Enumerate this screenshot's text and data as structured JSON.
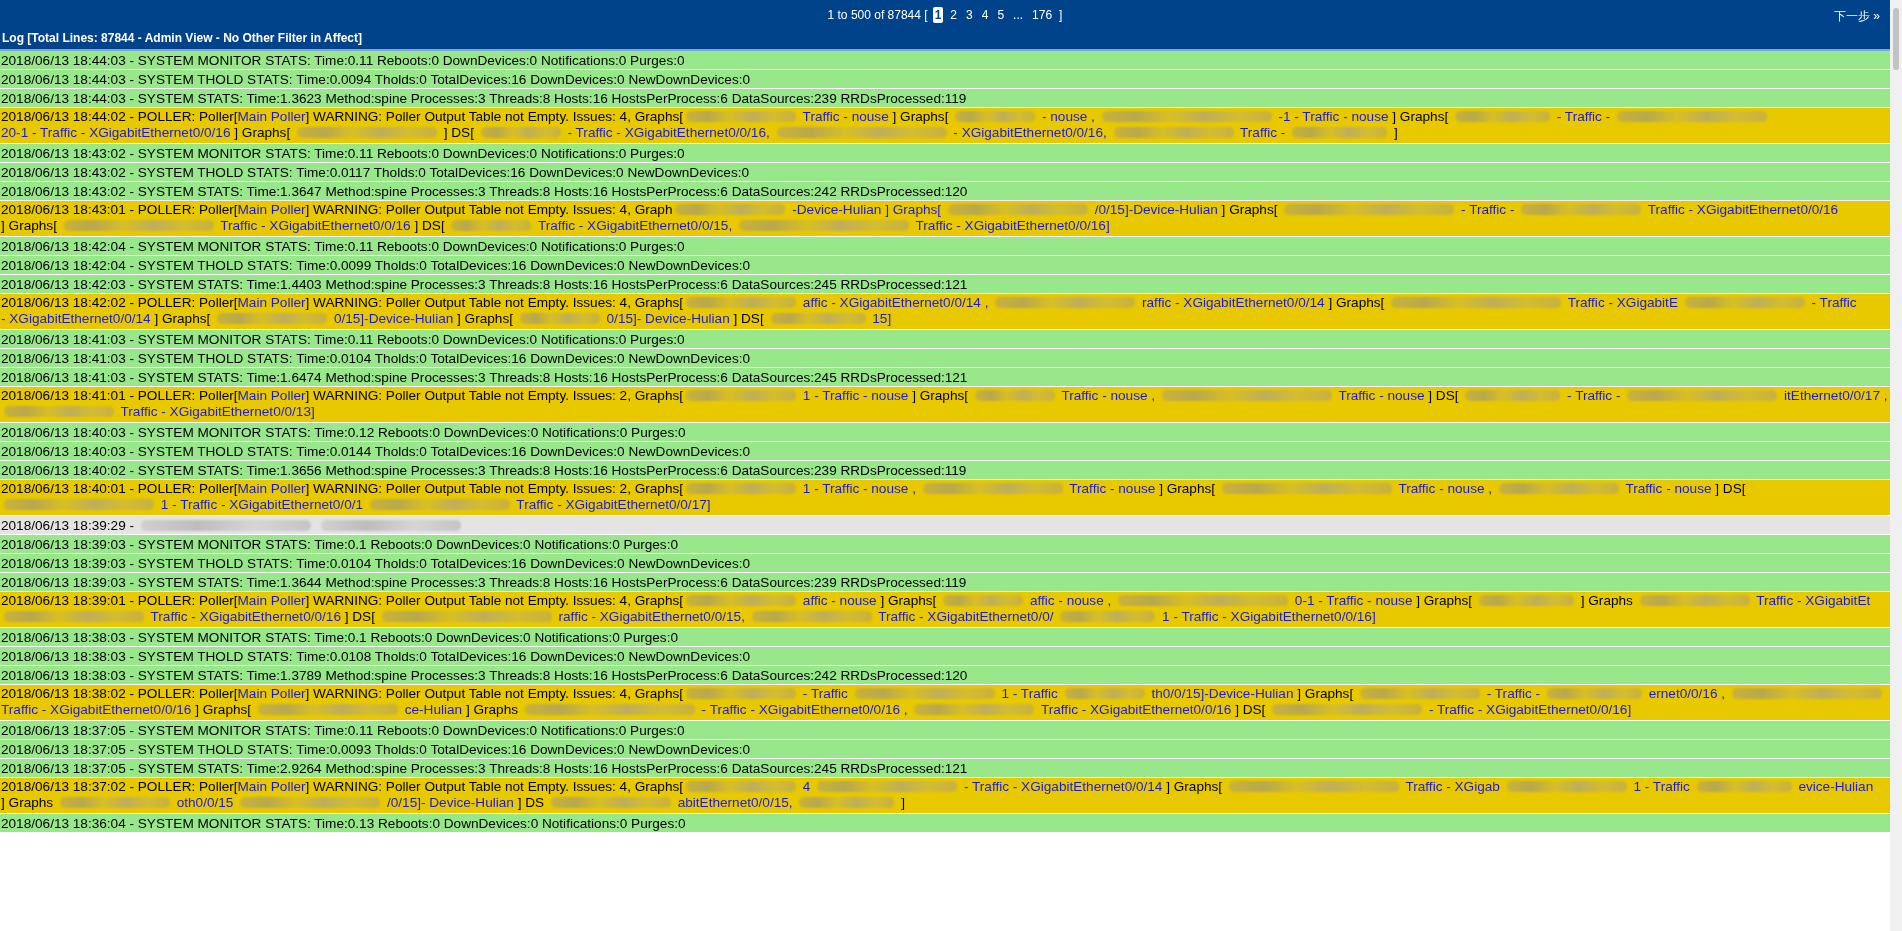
{
  "pager": {
    "summary": "1 to 500 of 87844 [",
    "pages": [
      {
        "label": "1",
        "selected": true
      },
      {
        "label": "2",
        "selected": false
      },
      {
        "label": "3",
        "selected": false
      },
      {
        "label": "4",
        "selected": false
      },
      {
        "label": "5",
        "selected": false
      },
      {
        "label": "...",
        "selected": false
      },
      {
        "label": "176",
        "selected": false
      }
    ],
    "close": "]",
    "next": "下一步 »"
  },
  "title": "Log [Total Lines: 87844 - Admin View - No Other Filter in Affect]",
  "rows": [
    {
      "kind": "info",
      "text": "2018/06/13 18:44:03 - SYSTEM MONITOR STATS: Time:0.11 Reboots:0 DownDevices:0 Notifications:0 Purges:0"
    },
    {
      "kind": "info",
      "text": "2018/06/13 18:44:03 - SYSTEM THOLD STATS: Time:0.0094 Tholds:0 TotalDevices:16 DownDevices:0 NewDownDevices:0"
    },
    {
      "kind": "info",
      "text": "2018/06/13 18:44:03 - SYSTEM STATS: Time:1.3623 Method:spine Processes:3 Threads:8 Hosts:16 HostsPerProcess:6 DataSources:239 RRDsProcessed:119"
    },
    {
      "kind": "warning",
      "prefix": "2018/06/13 18:44:02 - POLLER: Poller[",
      "link": "Main Poller",
      "message": "] WARNING: Poller Output Table not Empty. Issues: 4, Graphs[",
      "segments": [
        {
          "text": "Traffic - nouse",
          "link": true,
          "masked": true
        },
        {
          "text": "] Graphs[",
          "link": false,
          "masked": false
        },
        {
          "text": "- nouse ,",
          "link": true,
          "masked": true
        },
        {
          "text": "-1 - Traffic - nouse",
          "link": true,
          "masked": true
        },
        {
          "text": "] Graphs[",
          "link": false,
          "masked": false
        },
        {
          "text": "- Traffic -",
          "link": true,
          "masked": true
        },
        {
          "text": "20-1 - Traffic - XGigabitEthernet0/0/16",
          "link": true,
          "masked": true
        },
        {
          "text": "] Graphs[",
          "link": false,
          "masked": false
        },
        {
          "text": "] DS[",
          "link": false,
          "masked": true
        },
        {
          "text": "- Traffic - XGigabitEthernet0/0/16,",
          "link": true,
          "masked": true
        },
        {
          "text": "- XGigabitEthernet0/0/16,",
          "link": true,
          "masked": true
        },
        {
          "text": "Traffic -",
          "link": true,
          "masked": true
        },
        {
          "text": "]",
          "link": false,
          "masked": true
        }
      ]
    },
    {
      "kind": "info",
      "text": "2018/06/13 18:43:02 - SYSTEM MONITOR STATS: Time:0.11 Reboots:0 DownDevices:0 Notifications:0 Purges:0"
    },
    {
      "kind": "info",
      "text": "2018/06/13 18:43:02 - SYSTEM THOLD STATS: Time:0.0117 Tholds:0 TotalDevices:16 DownDevices:0 NewDownDevices:0"
    },
    {
      "kind": "info",
      "text": "2018/06/13 18:43:02 - SYSTEM STATS: Time:1.3647 Method:spine Processes:3 Threads:8 Hosts:16 HostsPerProcess:6 DataSources:242 RRDsProcessed:120"
    },
    {
      "kind": "warning",
      "prefix": "2018/06/13 18:43:01 - POLLER: Poller[",
      "link": "Main Poller",
      "message": "] WARNING: Poller Output Table not Empty. Issues: 4, Graph",
      "segments": [
        {
          "text": "-Device-Hulian ] Graphs[",
          "link": true,
          "masked": true
        },
        {
          "text": "/0/15]-Device-Hulian",
          "link": true,
          "masked": true
        },
        {
          "text": "] Graphs[",
          "link": false,
          "masked": false
        },
        {
          "text": "- Traffic -",
          "link": true,
          "masked": true
        },
        {
          "text": "Traffic - XGigabitEthernet0/0/16",
          "link": true,
          "masked": true
        },
        {
          "text": "] Graphs[",
          "link": false,
          "masked": false
        },
        {
          "text": "Traffic -",
          "link": true,
          "masked": true
        },
        {
          "text": "XGigabitEthernet0/0/16",
          "link": true,
          "masked": false
        },
        {
          "text": "] DS[",
          "link": false,
          "masked": false
        },
        {
          "text": "Traffic - XGigabitEthernet0/0/15,",
          "link": true,
          "masked": true
        },
        {
          "text": "Traffic - XGigabitEthernet0/0/16]",
          "link": true,
          "masked": true
        }
      ]
    },
    {
      "kind": "info",
      "text": "2018/06/13 18:42:04 - SYSTEM MONITOR STATS: Time:0.11 Reboots:0 DownDevices:0 Notifications:0 Purges:0"
    },
    {
      "kind": "info",
      "text": "2018/06/13 18:42:04 - SYSTEM THOLD STATS: Time:0.0099 Tholds:0 TotalDevices:16 DownDevices:0 NewDownDevices:0"
    },
    {
      "kind": "info",
      "text": "2018/06/13 18:42:03 - SYSTEM STATS: Time:1.4403 Method:spine Processes:3 Threads:8 Hosts:16 HostsPerProcess:6 DataSources:245 RRDsProcessed:121"
    },
    {
      "kind": "warning",
      "prefix": "2018/06/13 18:42:02 - POLLER: Poller[",
      "link": "Main Poller",
      "message": "] WARNING: Poller Output Table not Empty. Issues: 4, Graphs[",
      "segments": [
        {
          "text": "affic - XGigabitEthernet0/0/14 ,",
          "link": true,
          "masked": true
        },
        {
          "text": "raffic - XGigabitEthernet0/0/14",
          "link": true,
          "masked": true
        },
        {
          "text": "] Graphs[",
          "link": false,
          "masked": false
        },
        {
          "text": "Traffic - XGigabitE",
          "link": true,
          "masked": true
        },
        {
          "text": "- Traffic",
          "link": true,
          "masked": true
        },
        {
          "text": "- XGigabitEthernet0/0/14",
          "link": true,
          "masked": false
        },
        {
          "text": "] Graphs[",
          "link": false,
          "masked": false
        },
        {
          "text": "0/15]-Device-Hulian",
          "link": true,
          "masked": true
        },
        {
          "text": "] Graphs[",
          "link": false,
          "masked": false
        },
        {
          "text": "0/15]-",
          "link": true,
          "masked": true
        },
        {
          "text": "Device-Hulian",
          "link": true,
          "masked": false
        },
        {
          "text": "] DS[",
          "link": false,
          "masked": false
        },
        {
          "text": "15]",
          "link": true,
          "masked": true
        }
      ]
    },
    {
      "kind": "info",
      "text": "2018/06/13 18:41:03 - SYSTEM MONITOR STATS: Time:0.11 Reboots:0 DownDevices:0 Notifications:0 Purges:0"
    },
    {
      "kind": "info",
      "text": "2018/06/13 18:41:03 - SYSTEM THOLD STATS: Time:0.0104 Tholds:0 TotalDevices:16 DownDevices:0 NewDownDevices:0"
    },
    {
      "kind": "info",
      "text": "2018/06/13 18:41:03 - SYSTEM STATS: Time:1.6474 Method:spine Processes:3 Threads:8 Hosts:16 HostsPerProcess:6 DataSources:245 RRDsProcessed:121"
    },
    {
      "kind": "warning",
      "prefix": "2018/06/13 18:41:01 - POLLER: Poller[",
      "link": "Main Poller",
      "message": "] WARNING: Poller Output Table not Empty. Issues: 2, Graphs[",
      "segments": [
        {
          "text": "1 - Traffic - nouse",
          "link": true,
          "masked": true
        },
        {
          "text": "] Graphs[",
          "link": false,
          "masked": false
        },
        {
          "text": "Traffic - nouse ,",
          "link": true,
          "masked": true
        },
        {
          "text": "Traffic - nouse",
          "link": true,
          "masked": true
        },
        {
          "text": "] DS[",
          "link": false,
          "masked": false
        },
        {
          "text": "- Traffic -",
          "link": true,
          "masked": true
        },
        {
          "text": "itEthernet0/0/17 ,",
          "link": true,
          "masked": true
        },
        {
          "text": "Traffic - XGigabitEthernet0/0/13]",
          "link": true,
          "masked": true
        }
      ]
    },
    {
      "kind": "info",
      "text": "2018/06/13 18:40:03 - SYSTEM MONITOR STATS: Time:0.12 Reboots:0 DownDevices:0 Notifications:0 Purges:0"
    },
    {
      "kind": "info",
      "text": "2018/06/13 18:40:03 - SYSTEM THOLD STATS: Time:0.0144 Tholds:0 TotalDevices:16 DownDevices:0 NewDownDevices:0"
    },
    {
      "kind": "info",
      "text": "2018/06/13 18:40:02 - SYSTEM STATS: Time:1.3656 Method:spine Processes:3 Threads:8 Hosts:16 HostsPerProcess:6 DataSources:239 RRDsProcessed:119"
    },
    {
      "kind": "warning",
      "prefix": "2018/06/13 18:40:01 - POLLER: Poller[",
      "link": "Main Poller",
      "message": "] WARNING: Poller Output Table not Empty. Issues: 2, Graphs[",
      "segments": [
        {
          "text": "1 - Traffic - nouse ,",
          "link": true,
          "masked": true
        },
        {
          "text": "Traffic - nouse",
          "link": true,
          "masked": true
        },
        {
          "text": "] Graphs[",
          "link": false,
          "masked": false
        },
        {
          "text": "Traffic - nouse ,",
          "link": true,
          "masked": true
        },
        {
          "text": "Traffic - nouse",
          "link": true,
          "masked": true
        },
        {
          "text": "] DS[",
          "link": false,
          "masked": false
        },
        {
          "text": "1 - Traffic -",
          "link": true,
          "masked": true
        },
        {
          "text": "XGigabitEthernet0/0/1",
          "link": true,
          "masked": false
        },
        {
          "text": "Traffic - XGigabitEthernet0/0/17]",
          "link": true,
          "masked": true
        }
      ]
    },
    {
      "kind": "other",
      "text": "2018/06/13 18:39:29 -"
    },
    {
      "kind": "info",
      "text": "2018/06/13 18:39:03 - SYSTEM MONITOR STATS: Time:0.1 Reboots:0 DownDevices:0 Notifications:0 Purges:0"
    },
    {
      "kind": "info",
      "text": "2018/06/13 18:39:03 - SYSTEM THOLD STATS: Time:0.0104 Tholds:0 TotalDevices:16 DownDevices:0 NewDownDevices:0"
    },
    {
      "kind": "info",
      "text": "2018/06/13 18:39:03 - SYSTEM STATS: Time:1.3644 Method:spine Processes:3 Threads:8 Hosts:16 HostsPerProcess:6 DataSources:239 RRDsProcessed:119"
    },
    {
      "kind": "warning",
      "prefix": "2018/06/13 18:39:01 - POLLER: Poller[",
      "link": "Main Poller",
      "message": "] WARNING: Poller Output Table not Empty. Issues: 4, Graphs[",
      "segments": [
        {
          "text": "affic - nouse",
          "link": true,
          "masked": true
        },
        {
          "text": "] Graphs[",
          "link": false,
          "masked": false
        },
        {
          "text": "affic - nouse ,",
          "link": true,
          "masked": true
        },
        {
          "text": "0-1 - Traffic - nouse",
          "link": true,
          "masked": true
        },
        {
          "text": "] Graphs[",
          "link": false,
          "masked": false
        },
        {
          "text": "]",
          "link": false,
          "masked": true
        },
        {
          "text": "Graphs",
          "link": false,
          "masked": false
        },
        {
          "text": "Traffic - XGigabitEt",
          "link": true,
          "masked": true
        },
        {
          "text": "Traffic - XGigabitEthernet0/0/16",
          "link": true,
          "masked": true
        },
        {
          "text": "] DS[",
          "link": false,
          "masked": false
        },
        {
          "text": "raffic - XGigabitEthernet0/0/15,",
          "link": true,
          "masked": true
        },
        {
          "text": "Traffic - XGigabitEthernet0/0/",
          "link": true,
          "masked": true
        },
        {
          "text": "1 - Traffic - XGigabitEthernet0/0/16]",
          "link": true,
          "masked": true
        }
      ]
    },
    {
      "kind": "info",
      "text": "2018/06/13 18:38:03 - SYSTEM MONITOR STATS: Time:0.1 Reboots:0 DownDevices:0 Notifications:0 Purges:0"
    },
    {
      "kind": "info",
      "text": "2018/06/13 18:38:03 - SYSTEM THOLD STATS: Time:0.0108 Tholds:0 TotalDevices:16 DownDevices:0 NewDownDevices:0"
    },
    {
      "kind": "info",
      "text": "2018/06/13 18:38:03 - SYSTEM STATS: Time:1.3789 Method:spine Processes:3 Threads:8 Hosts:16 HostsPerProcess:6 DataSources:242 RRDsProcessed:120"
    },
    {
      "kind": "warning",
      "prefix": "2018/06/13 18:38:02 - POLLER: Poller[",
      "link": "Main Poller",
      "message": "] WARNING: Poller Output Table not Empty. Issues: 4, Graphs[",
      "segments": [
        {
          "text": "- Traffic",
          "link": true,
          "masked": true
        },
        {
          "text": "1 - Traffic",
          "link": true,
          "masked": true
        },
        {
          "text": "th0/0/15]-Device-Hulian",
          "link": true,
          "masked": true
        },
        {
          "text": "] Graphs[",
          "link": false,
          "masked": false
        },
        {
          "text": "- Traffic -",
          "link": true,
          "masked": true
        },
        {
          "text": "ernet0/0/16 ,",
          "link": true,
          "masked": true
        },
        {
          "text": "Traffic - XGigabitEthernet0/0/16",
          "link": true,
          "masked": true
        },
        {
          "text": "] Graphs[",
          "link": false,
          "masked": false
        },
        {
          "text": "ce-Hulian",
          "link": true,
          "masked": true
        },
        {
          "text": "] Graphs",
          "link": false,
          "masked": false
        },
        {
          "text": "- Traffic - XGigabitEthernet0/0/16 ,",
          "link": true,
          "masked": true
        },
        {
          "text": "Traffic - XGigabitEthernet0/0/16",
          "link": true,
          "masked": true
        },
        {
          "text": "] DS[",
          "link": false,
          "masked": false
        },
        {
          "text": "- Traffic - XGigabitEthernet0/0/16]",
          "link": true,
          "masked": true
        }
      ]
    },
    {
      "kind": "info",
      "text": "2018/06/13 18:37:05 - SYSTEM MONITOR STATS: Time:0.11 Reboots:0 DownDevices:0 Notifications:0 Purges:0"
    },
    {
      "kind": "info",
      "text": "2018/06/13 18:37:05 - SYSTEM THOLD STATS: Time:0.0093 Tholds:0 TotalDevices:16 DownDevices:0 NewDownDevices:0"
    },
    {
      "kind": "info",
      "text": "2018/06/13 18:37:05 - SYSTEM STATS: Time:2.9264 Method:spine Processes:3 Threads:8 Hosts:16 HostsPerProcess:6 DataSources:245 RRDsProcessed:121"
    },
    {
      "kind": "warning",
      "prefix": "2018/06/13 18:37:02 - POLLER: Poller[",
      "link": "Main Poller",
      "message": "] WARNING: Poller Output Table not Empty. Issues: 4, Graphs[",
      "segments": [
        {
          "text": "4",
          "link": true,
          "masked": true
        },
        {
          "text": "- Traffic - XGigabitEthernet0/0/14",
          "link": true,
          "masked": true
        },
        {
          "text": "] Graphs[",
          "link": false,
          "masked": false
        },
        {
          "text": "Traffic - XGigab",
          "link": true,
          "masked": true
        },
        {
          "text": "1 - Traffic",
          "link": true,
          "masked": true
        },
        {
          "text": "evice-Hulian",
          "link": true,
          "masked": true
        },
        {
          "text": "] Graphs",
          "link": false,
          "masked": false
        },
        {
          "text": "oth0/0/15",
          "link": true,
          "masked": true
        },
        {
          "text": "/0/15]-",
          "link": true,
          "masked": true
        },
        {
          "text": "Device-Hulian",
          "link": true,
          "masked": false
        },
        {
          "text": "] DS",
          "link": false,
          "masked": false
        },
        {
          "text": "abitEthernet0/0/15,",
          "link": true,
          "masked": true
        },
        {
          "text": "]",
          "link": false,
          "masked": true
        }
      ]
    },
    {
      "kind": "info",
      "text": "2018/06/13 18:36:04 - SYSTEM MONITOR STATS: Time:0.13 Reboots:0 DownDevices:0 Notifications:0 Purges:0"
    }
  ]
}
